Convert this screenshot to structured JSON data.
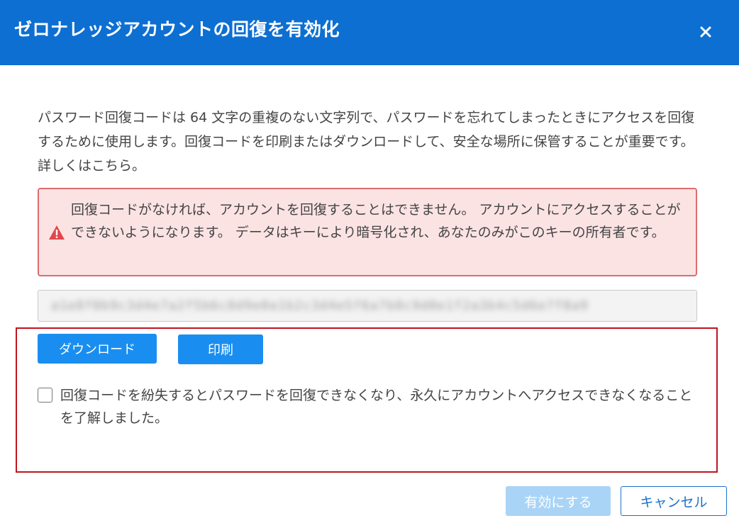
{
  "dialog": {
    "title": "ゼロナレッジアカウントの回復を有効化",
    "close_icon": "close-icon"
  },
  "intro": {
    "text": "パスワード回復コードは 64 文字の重複のない文字列で、パスワードを忘れてしまったときにアクセスを回復するために使用します。回復コードを印刷またはダウンロードして、安全な場所に保管することが重要です。詳しくはこちら。"
  },
  "warning": {
    "icon": "warning-triangle-icon",
    "text": "回復コードがなければ、アカウントを回復することはできません。 アカウントにアクセスすることができないようになります。 データはキーにより暗号化され、あなたのみがこのキーの所有者です。",
    "color": "#de6b70"
  },
  "recovery_code": {
    "value": "a1e8f0b9c3d4e7a2f5b6c8d9e0a1b2c3d4e5f6a7b8c9d0e1f2a3b4c5d6e7f8a9"
  },
  "actions": {
    "download_label": "ダウンロード",
    "print_label": "印刷"
  },
  "acknowledge": {
    "label": "回復コードを紛失するとパスワードを回復できなくなり、永久にアカウントへアクセスできなくなることを了解しました。",
    "checked": false
  },
  "footer": {
    "enable_label": "有効にする",
    "cancel_label": "キャンセル"
  },
  "colors": {
    "header": "#0d6fd1",
    "primary": "#1a8ef0",
    "highlight": "#c0141f"
  }
}
